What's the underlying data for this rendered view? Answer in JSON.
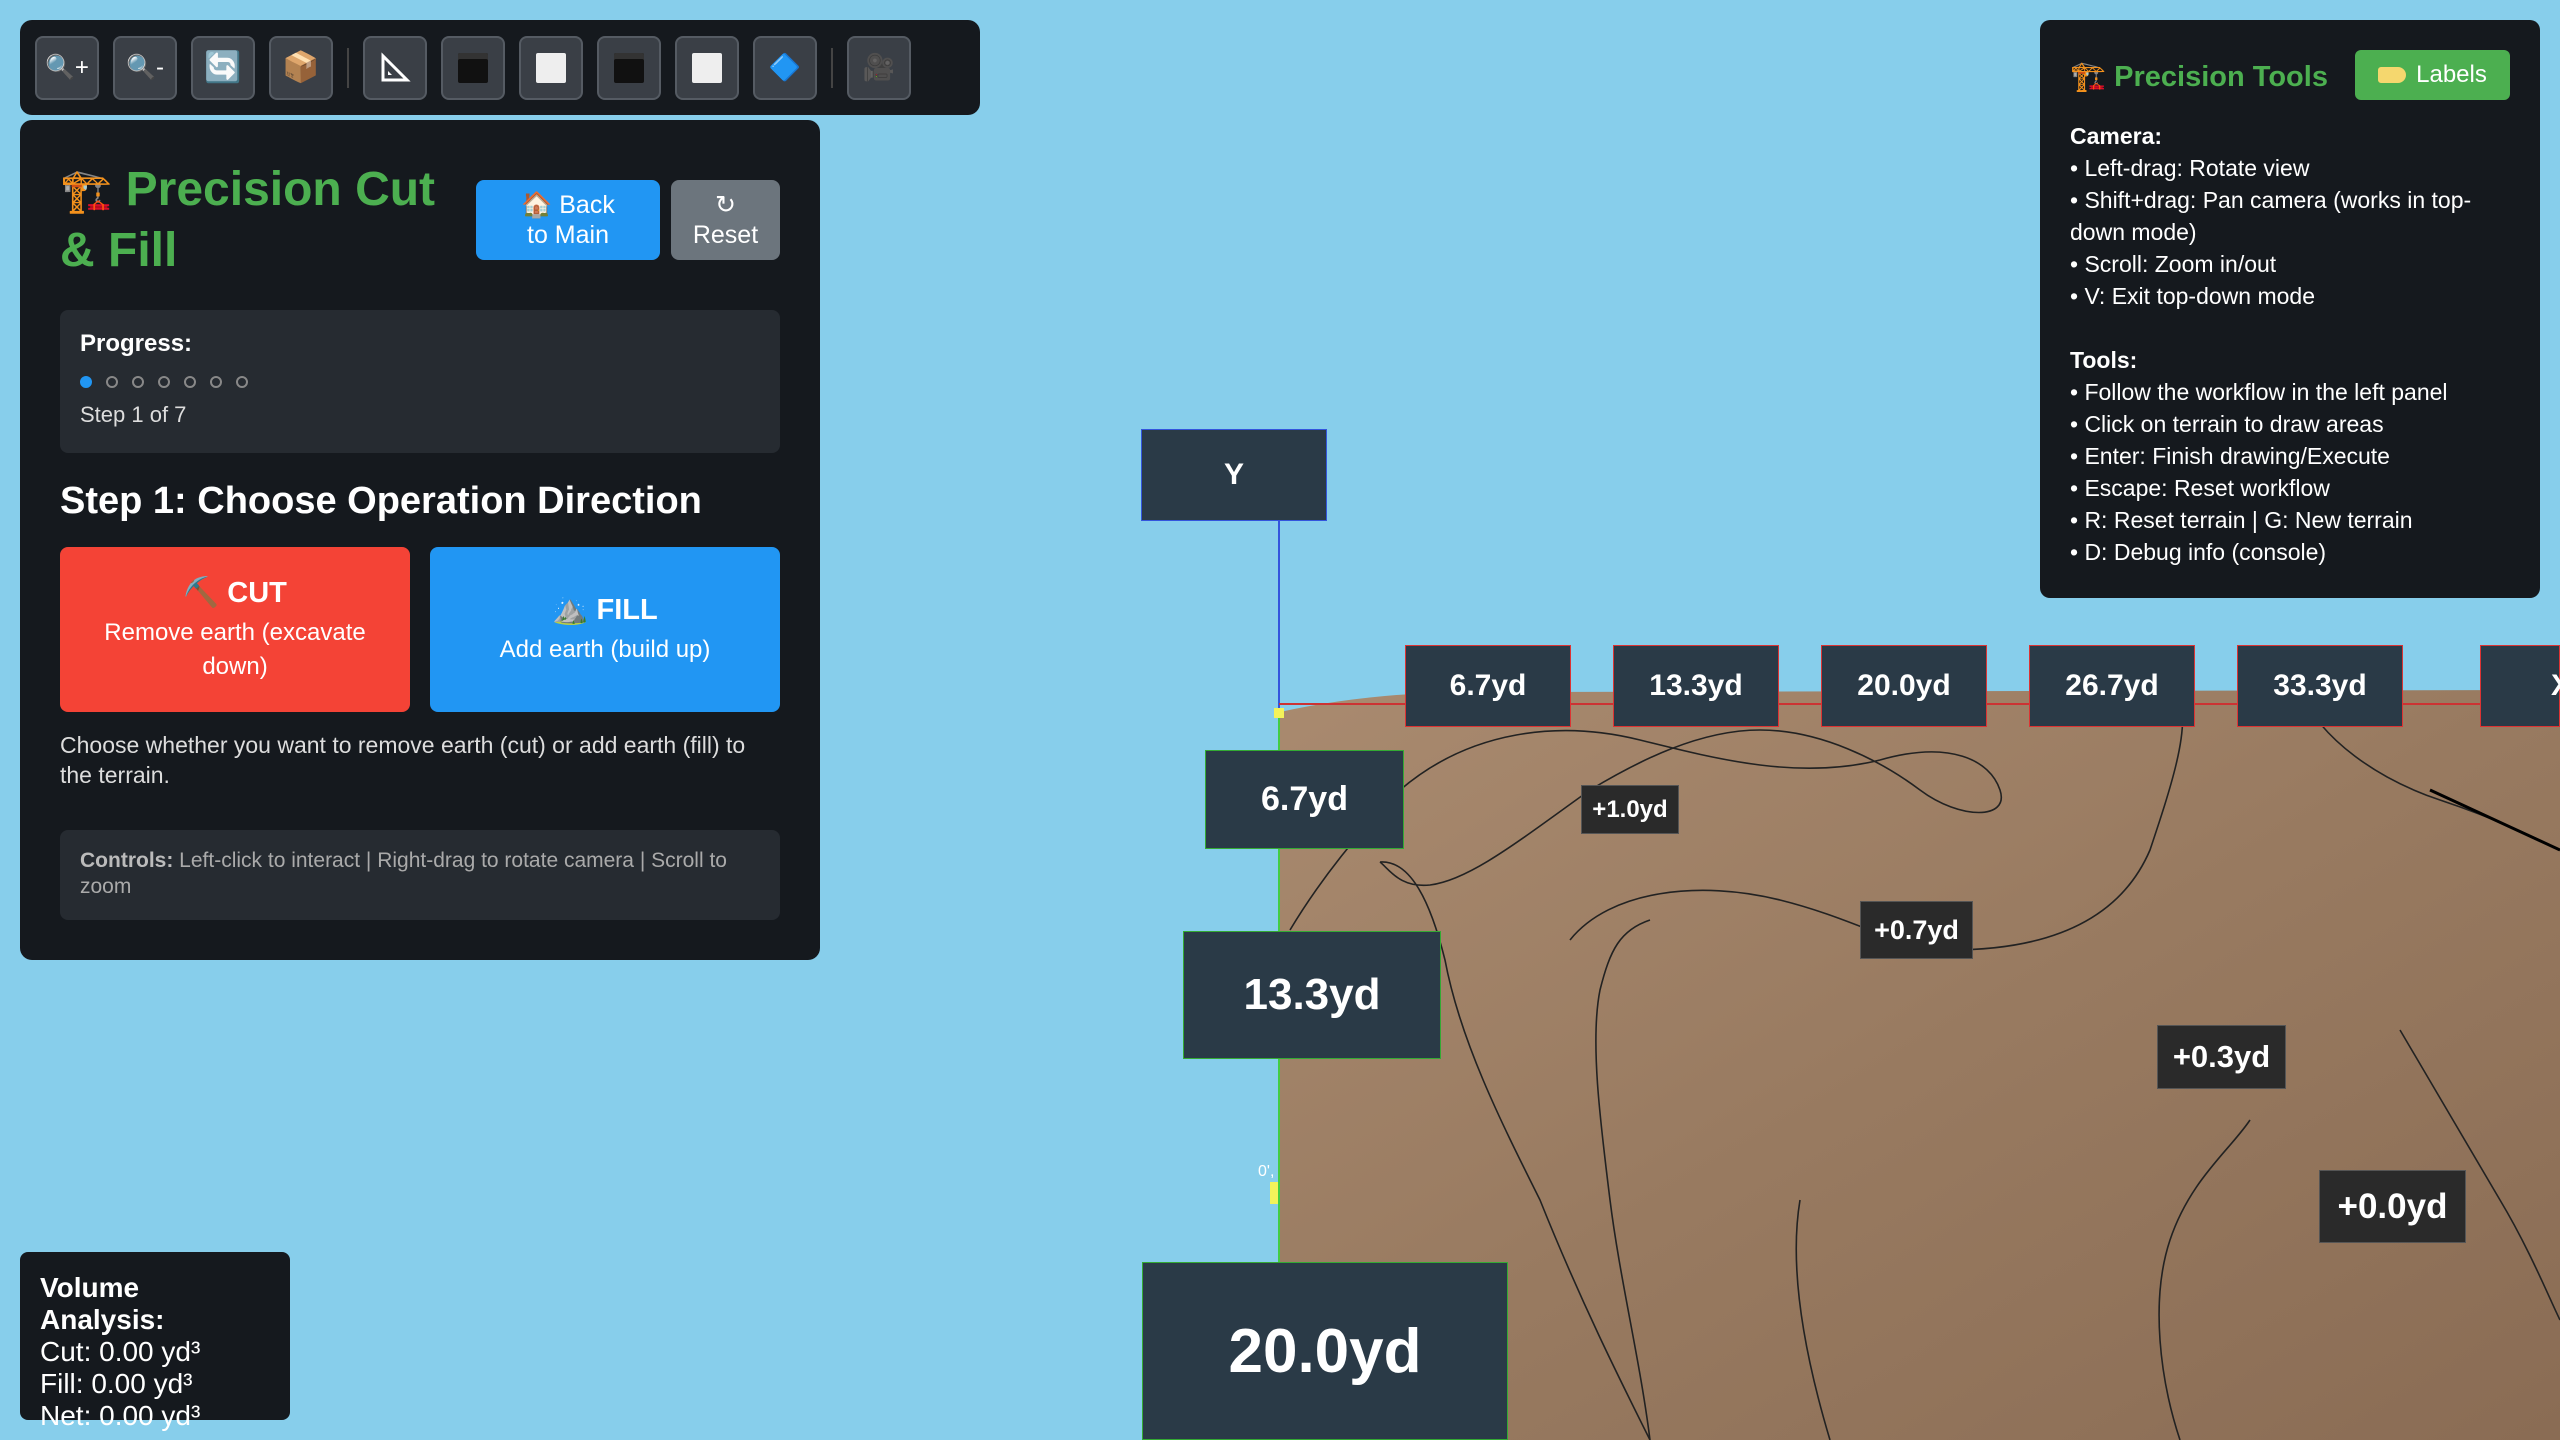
{
  "toolbar": {
    "buttons": [
      {
        "name": "zoom-in",
        "glyph": "🔍+"
      },
      {
        "name": "zoom-out",
        "glyph": "🔍-"
      },
      {
        "name": "refresh",
        "glyph": "🔄"
      },
      {
        "name": "box",
        "glyph": "📦"
      },
      {
        "name": "measure",
        "glyph": "📐"
      },
      {
        "name": "view-dark-1"
      },
      {
        "name": "view-light-1"
      },
      {
        "name": "view-dark-2"
      },
      {
        "name": "view-light-2"
      },
      {
        "name": "diamond",
        "glyph": "🔷"
      },
      {
        "name": "camera",
        "glyph": "🎥"
      }
    ]
  },
  "left_panel": {
    "title_icon": "🏗️",
    "title": "Precision Cut & Fill",
    "back_icon": "🏠",
    "back_label": "Back to Main",
    "reset_icon": "↻",
    "reset_label": "Reset",
    "progress_title": "Progress:",
    "progress_step": "Step 1 of 7",
    "progress_current": 1,
    "progress_total": 7,
    "step_title": "Step 1: Choose Operation Direction",
    "cut": {
      "icon": "⛏️",
      "name": "CUT",
      "desc": "Remove earth (excavate down)"
    },
    "fill": {
      "icon": "⛰️",
      "name": "FILL",
      "desc": "Add earth (build up)"
    },
    "hint": "Choose whether you want to remove earth (cut) or add earth (fill) to the terrain.",
    "controls_label": "Controls:",
    "controls_text": "Left-click to interact | Right-drag to rotate camera | Scroll to zoom"
  },
  "right_panel": {
    "title_icon": "🏗️",
    "title": "Precision Tools",
    "labels_btn": "Labels",
    "camera_title": "Camera:",
    "camera_items": [
      "• Left-drag: Rotate view",
      "• Shift+drag: Pan camera (works in top-down mode)",
      "• Scroll: Zoom in/out",
      "• V: Exit top-down mode"
    ],
    "tools_title": "Tools:",
    "tools_items": [
      "• Follow the workflow in the left panel",
      "• Click on terrain to draw areas",
      "• Enter: Finish drawing/Execute",
      "• Escape: Reset workflow",
      "• R: Reset terrain | G: New terrain",
      "• D: Debug info (console)"
    ]
  },
  "volume": {
    "title": "Volume Analysis:",
    "cut": "Cut: 0.00 yd³",
    "fill": "Fill: 0.00 yd³",
    "net": "Net: 0.00 yd³"
  },
  "scene": {
    "axis_label": "Y",
    "top_labels": [
      "6.7yd",
      "13.3yd",
      "20.0yd",
      "26.7yd",
      "33.3yd",
      "X"
    ],
    "left_labels": [
      "6.7yd",
      "13.3yd",
      "20.0yd"
    ],
    "elevation_labels": [
      "+1.0yd",
      "+0.7yd",
      "+0.3yd",
      "+0.0yd"
    ],
    "origin_tick_top": "0'",
    "origin_tick_bottom": "0',"
  }
}
